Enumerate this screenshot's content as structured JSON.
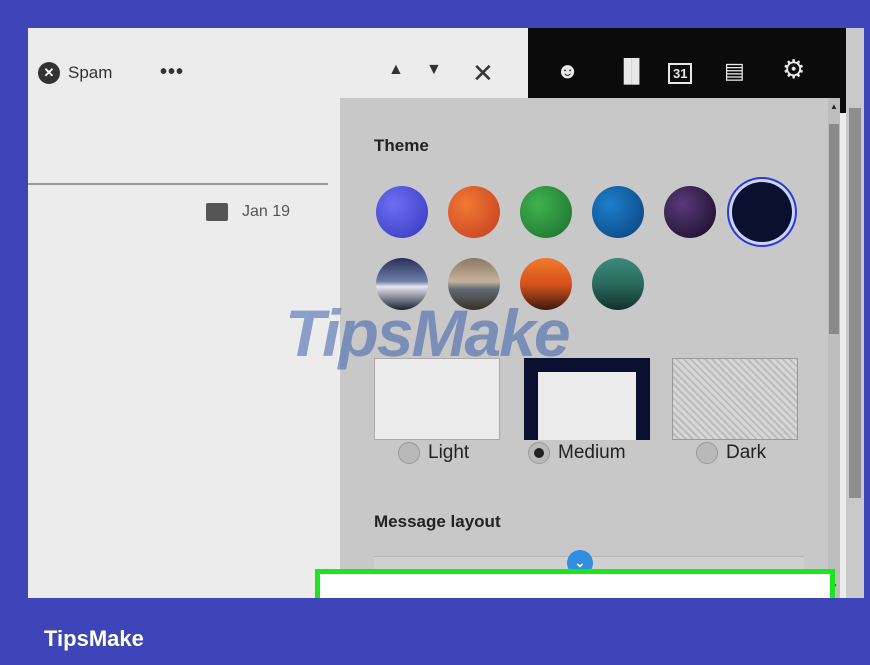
{
  "header": {
    "spam_label": "Spam",
    "more_label": "•••",
    "up_arrow": "▲",
    "down_arrow": "▼",
    "close_label": "✕"
  },
  "toolbar_icons": [
    "emoji-icon",
    "columns-icon",
    "calendar-icon",
    "notepad-icon",
    "gear-icon"
  ],
  "calendar_day": "31",
  "message": {
    "date": "Jan 19"
  },
  "settings_panel": {
    "theme_heading": "Theme",
    "theme_colors": [
      "#4146d9",
      "#e0552a",
      "#2a8f3c",
      "#0f5fa6",
      "#2a1840",
      "#0b1030"
    ],
    "selected_theme": 5,
    "photo_themes": [
      "mountains",
      "boat",
      "sunset-tree",
      "forest"
    ],
    "density_options": [
      {
        "label": "Light",
        "selected": false
      },
      {
        "label": "Medium",
        "selected": true
      },
      {
        "label": "Dark",
        "selected": false
      }
    ],
    "layout_heading": "Message layout"
  },
  "watermark": "TipsMake",
  "brand": "TipsMake"
}
